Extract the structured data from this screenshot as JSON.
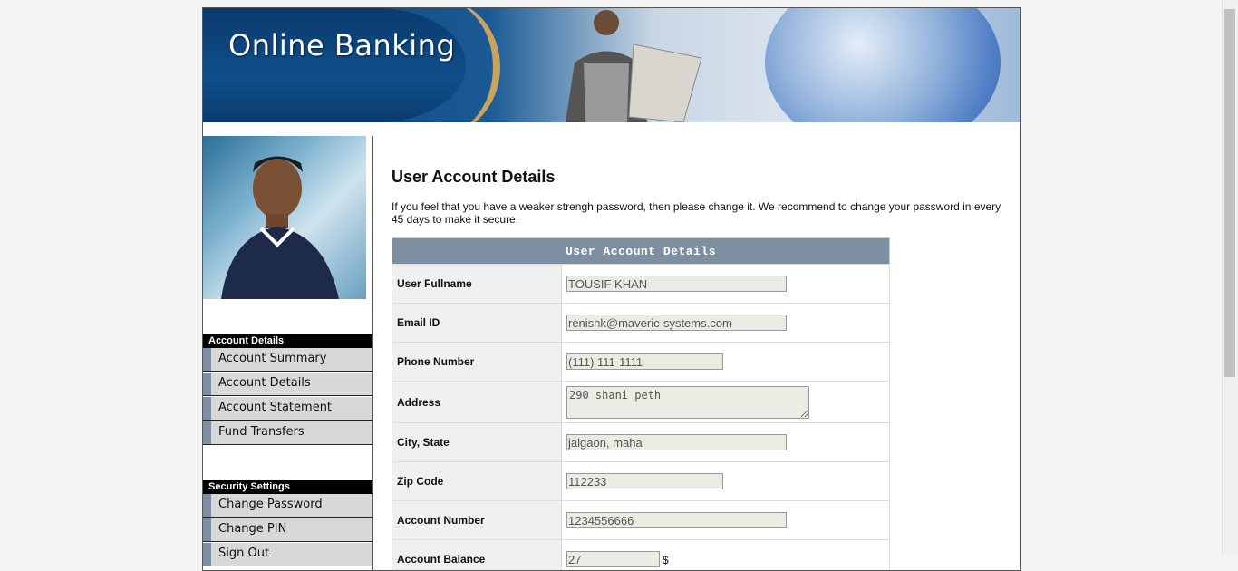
{
  "banner": {
    "title": "Online Banking"
  },
  "sidebar": {
    "sections": [
      {
        "header": "Account Details",
        "items": [
          {
            "label": "Account Summary"
          },
          {
            "label": "Account Details"
          },
          {
            "label": "Account Statement"
          },
          {
            "label": "Fund Transfers"
          }
        ]
      },
      {
        "header": "Security Settings",
        "items": [
          {
            "label": "Change Password"
          },
          {
            "label": "Change PIN"
          },
          {
            "label": "Sign Out"
          }
        ]
      }
    ]
  },
  "main": {
    "title": "User Account Details",
    "intro": "If you feel that you have a weaker strengh password, then please change it. We recommend to change your password in every 45 days to make it secure.",
    "table_header": "User Account Details",
    "fields": [
      {
        "label": "User Fullname",
        "value": "TOUSIF KHAN"
      },
      {
        "label": "Email ID",
        "value": "renishk@maveric-systems.com"
      },
      {
        "label": "Phone Number",
        "value": "(111) 111-1111"
      },
      {
        "label": "Address",
        "value": "290 shani peth"
      },
      {
        "label": "City, State",
        "value": "jalgaon, maha"
      },
      {
        "label": "Zip Code",
        "value": "112233"
      },
      {
        "label": "Account Number",
        "value": "1234556666"
      },
      {
        "label": "Account Balance",
        "value": "27",
        "unit": "$"
      }
    ]
  },
  "colors": {
    "accent": "#7d8fa1",
    "banner_blue": "#0f4f8a"
  }
}
